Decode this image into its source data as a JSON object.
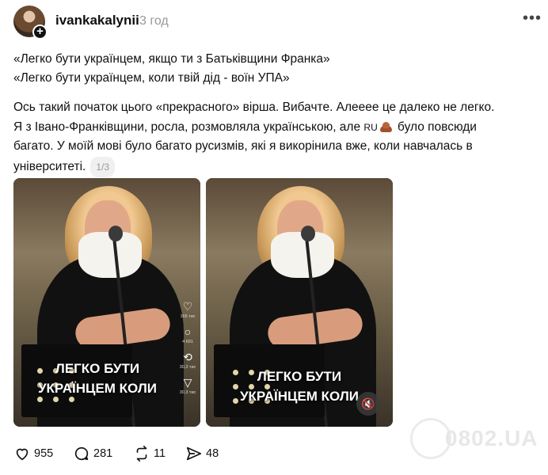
{
  "header": {
    "username": "ivankakalynii",
    "time": "3 год",
    "more_icon": "more-dots-icon"
  },
  "post": {
    "quote1": "«Легко бути українцем, якщо ти з Батьківщини Франка»",
    "quote2": "«Легко бути українцем, коли твій дід - воїн УПА»",
    "line1": "Ось такий початок цього «прекрасного» вірша. Вибачте. Алееее це далеко не легко.",
    "line2_a": "Я з Івано-Франківщини, росла, розмовляла українською, але ",
    "ru_tag": "RU",
    "line2_b": " було повсюди",
    "line3": "багато. У моїй мові було багато русизмів, які я викорінила вже, коли навчалась в",
    "line4": "університеті.",
    "page_indicator": "1/3"
  },
  "media": [
    {
      "overlay_line1": "ЛЕГКО БУТИ",
      "overlay_line2": "УКРАЇНЦЕМ КОЛИ",
      "side_counts": [
        "165 тис",
        "4 691",
        "30,3 тис",
        "30,3 тис"
      ]
    },
    {
      "overlay_line1": "ЛЕГКО БУТИ",
      "overlay_line2": "УКРАЇНЦЕМ КОЛИ",
      "mute_icon": "speaker-muted-icon"
    }
  ],
  "actions": {
    "likes": "955",
    "replies": "281",
    "reposts": "11",
    "shares": "48"
  },
  "watermark": {
    "text": "0802.UA"
  },
  "colors": {
    "text": "#101010",
    "muted": "#999999"
  }
}
